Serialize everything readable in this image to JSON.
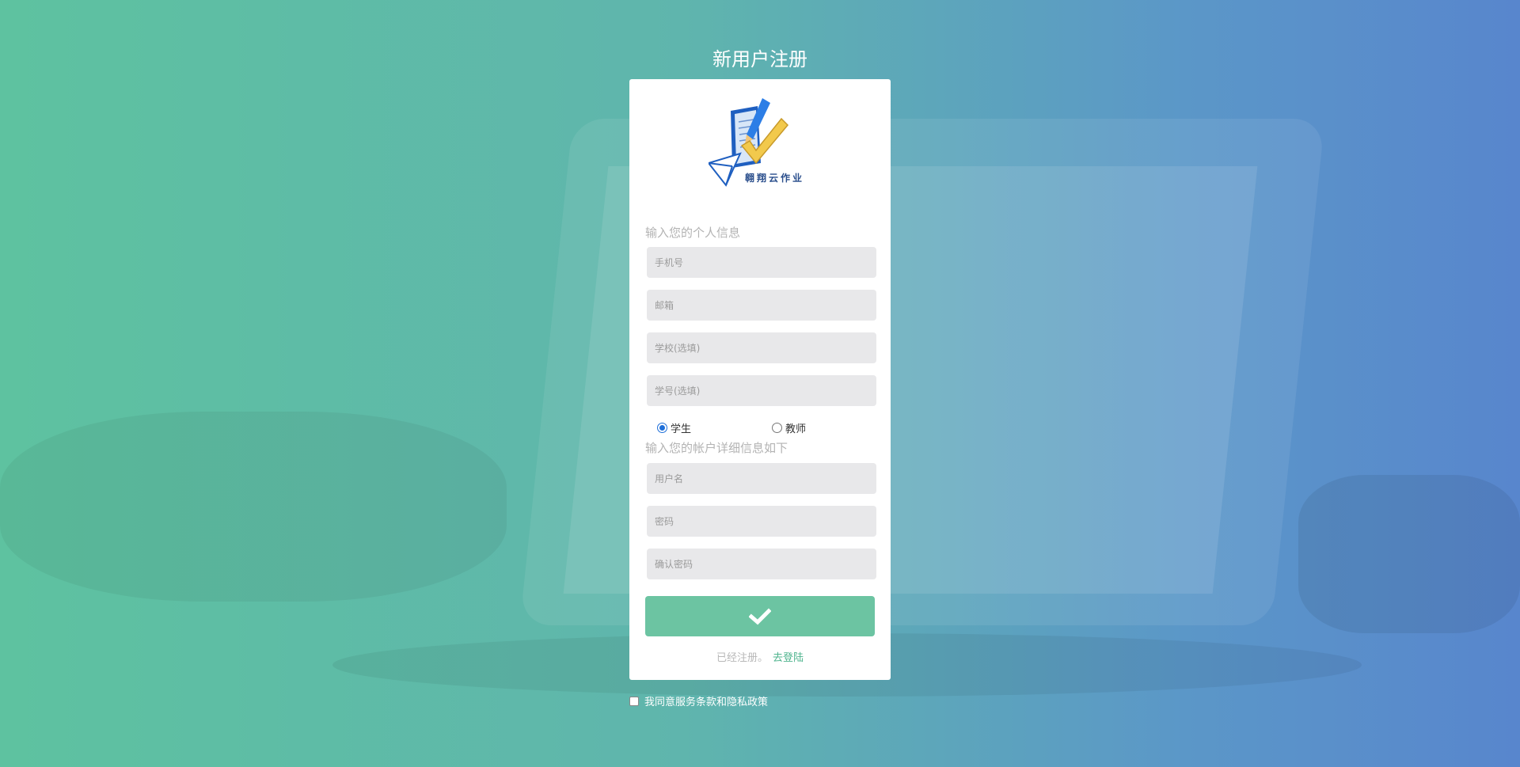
{
  "page": {
    "title": "新用户注册"
  },
  "logo": {
    "text": "翱翔云作业"
  },
  "personal_section": {
    "label": "输入您的个人信息",
    "phone_placeholder": "手机号",
    "email_placeholder": "邮箱",
    "school_placeholder": "学校(选填)",
    "student_id_placeholder": "学号(选填)"
  },
  "role": {
    "options": [
      {
        "label": "学生",
        "selected": true
      },
      {
        "label": "教师",
        "selected": false
      }
    ]
  },
  "account_section": {
    "label": "输入您的帐户详细信息如下",
    "username_placeholder": "用户名",
    "password_placeholder": "密码",
    "confirm_placeholder": "确认密码"
  },
  "submit": {
    "icon": "check-icon"
  },
  "login": {
    "prompt": "已经注册。",
    "link": "去登陆"
  },
  "agreement": {
    "label": "我同意服务条款和隐私政策",
    "checked": false
  },
  "colors": {
    "accent": "#6cc4a2",
    "link": "#4fb48e",
    "field_bg": "#e8e8ea"
  }
}
